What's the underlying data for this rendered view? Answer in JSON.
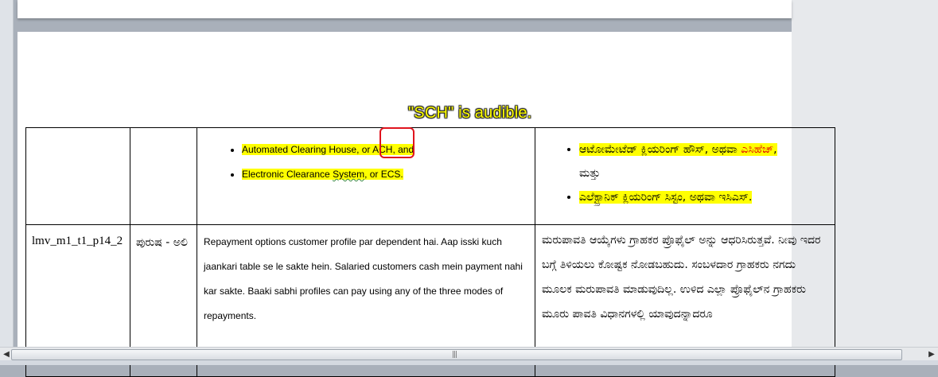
{
  "annotation": "\"SCH\" is audible.",
  "row1": {
    "english_bullets": [
      {
        "before": "Automated Clearing House, or ",
        "term": "ACH",
        "after": ", and"
      },
      {
        "before": "Electronic Clearance ",
        "term": "System",
        "after": ", or ECS."
      }
    ],
    "kannada_bullets": [
      {
        "text": "ಆಟೋಮೇಟೆಡ್ ಕ್ಲಿಯರಿಂಗ್ ಹೌಸ್, ಅಥವಾ ",
        "red": "ಎಸಿಹೆಚ್",
        "after": ",",
        "cont": "ಮತ್ತು"
      },
      {
        "text": "ಎಲೆಕ್ಟ್ರಾನಿಕ್ ಕ್ಲಿಯರಿಂಗ್ ಸಿಸ್ಟಂ, ಅಥವಾ ಇಸಿಎಸ್."
      }
    ]
  },
  "row2": {
    "code": "lmv_m1_t1_p14_2",
    "speaker": "ಪುರುಷ - ಅಲಿ",
    "english": "Repayment options customer profile par dependent hai. Aap isski kuch jaankari table se le sakte hein. Salaried customers cash mein payment nahi kar sakte. Baaki sabhi profiles can pay using any of the three modes of repayments.",
    "kannada": "ಮರುಪಾವತಿ ಆಯ್ಕೆಗಳು ಗ್ರಾಹಕರ ಪ್ರೊಫೈಲ್ ಅನ್ನು ಆಧರಿಸಿರುತ್ತವೆ. ನೀವು ಇದರ ಬಗ್ಗೆ ತಿಳಿಯಲು ಕೋಷ್ಟಕ ನೋಡಬಹುದು. ಸಂಬಳದಾರ ಗ್ರಾಹಕರು ನಗದು ಮೂಲಕ ಮರುಪಾವತಿ ಮಾಡುವುದಿಲ್ಲ. ಉಳಿದ ಎಲ್ಲಾ ಪ್ರೊಫೈಲ್‌ನ ಗ್ರಾಹಕರು ಮೂರು ಪಾವತಿ ವಿಧಾನಗಳಲ್ಲಿ ಯಾವುದನ್ನಾದರೂ"
  },
  "icons": {
    "scroll_left": "arrow-left-icon",
    "scroll_right": "arrow-right-icon",
    "grip": "grip-icon"
  }
}
